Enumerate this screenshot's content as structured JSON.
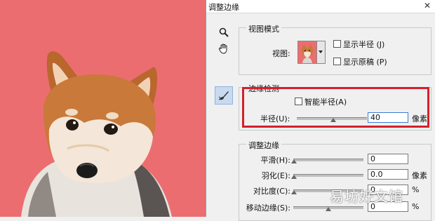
{
  "window": {
    "title": "调整边缘",
    "close_glyph": "✕"
  },
  "tools": [
    {
      "name": "zoom-tool",
      "icon": "magnifier-icon"
    },
    {
      "name": "hand-tool",
      "icon": "hand-icon"
    },
    {
      "name": "refine-radius-tool",
      "icon": "brush-icon",
      "active": true
    }
  ],
  "view_mode": {
    "legend": "视图模式",
    "view_label": "视图:",
    "show_radius": {
      "label": "显示半径 (J)",
      "checked": false
    },
    "show_original": {
      "label": "显示原稿 (P)",
      "checked": false
    }
  },
  "edge_detection": {
    "legend": "边缘检测",
    "smart_radius": {
      "label": "智能半径(A)",
      "checked": false
    },
    "radius": {
      "label": "半径(U):",
      "value": "40",
      "unit": "像素",
      "slider_fraction": 0.5
    }
  },
  "adjust_edge": {
    "legend": "调整边缘",
    "smooth": {
      "label": "平滑(H):",
      "value": "0",
      "unit": "",
      "slider_fraction": 0.0
    },
    "feather": {
      "label": "羽化(E):",
      "value": "0.0",
      "unit": "像素",
      "slider_fraction": 0.0
    },
    "contrast": {
      "label": "对比度(C):",
      "value": "0",
      "unit": "%",
      "slider_fraction": 0.0
    },
    "shift_edge": {
      "label": "移动边缘(S):",
      "value": "0",
      "unit": "%",
      "slider_fraction": 0.5
    }
  },
  "watermark": "易坊好文馆",
  "colors": {
    "background_red": "#ec6d70",
    "highlight_red": "#d4202c",
    "accent_blue": "#3b7bd6"
  }
}
